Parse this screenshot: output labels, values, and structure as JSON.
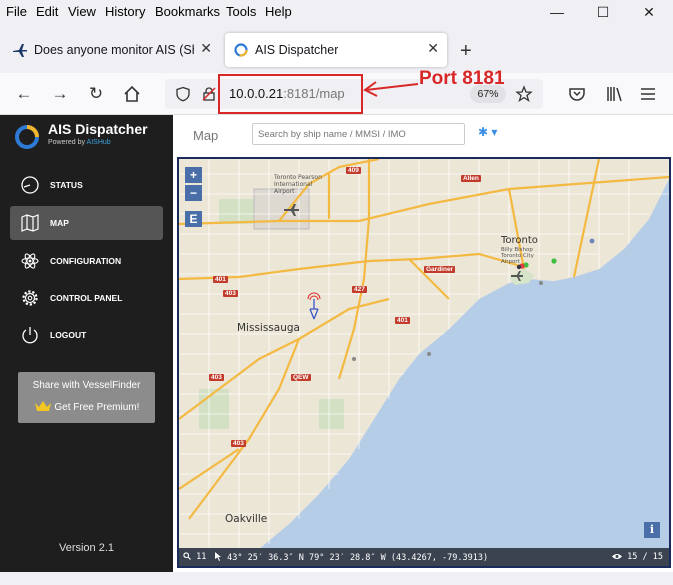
{
  "menubar": {
    "items": [
      "File",
      "Edit",
      "View",
      "History",
      "Bookmarks",
      "Tools",
      "Help"
    ],
    "window_controls": {
      "minimize": "—",
      "maximize": "☐",
      "close": "✕"
    }
  },
  "tabs": [
    {
      "label": "Does anyone monitor AIS (Ship",
      "icon": "airplane-icon",
      "close": "✕",
      "active": false
    },
    {
      "label": "AIS Dispatcher",
      "icon": "loading-ring-icon",
      "close": "✕",
      "active": true
    }
  ],
  "newtab": "+",
  "navbar": {
    "url_host": "10.0.0.21",
    "url_path": ":8181/map",
    "zoom": "67%"
  },
  "annotation": {
    "text": "Port 8181",
    "color": "#d82727"
  },
  "sidebar": {
    "title": "AIS Dispatcher",
    "subtitle_prefix": "Powered by ",
    "subtitle_link": "AISHub",
    "items": [
      {
        "label": "STATUS",
        "icon": "clock-icon",
        "active": false
      },
      {
        "label": "MAP",
        "icon": "map-icon",
        "active": true
      },
      {
        "label": "CONFIGURATION",
        "icon": "atom-icon",
        "active": false
      },
      {
        "label": "CONTROL PANEL",
        "icon": "gear-icon",
        "active": false
      },
      {
        "label": "LOGOUT",
        "icon": "power-icon",
        "active": false
      }
    ],
    "promo_line1": "Share with VesselFinder",
    "promo_line2": "Get Free Premium!",
    "version": "Version 2.1"
  },
  "main": {
    "title": "Map",
    "search_placeholder": "Search by ship name / MMSI / IMO",
    "map": {
      "zoom_in": "+",
      "zoom_out": "−",
      "layer_button": "E",
      "info_button": "i",
      "places": {
        "toronto": "Toronto",
        "mississauga": "Mississauga",
        "oakville": "Oakville",
        "airport": "Toronto Pearson International Airport",
        "billy_bishop": "Billy Bishop Toronto City Airport",
        "gardiner": "Gardiner",
        "allen": "Allen",
        "qew": "QEW"
      },
      "highways": [
        "409",
        "401",
        "427",
        "403",
        "403",
        "403",
        "401"
      ],
      "status": {
        "search_count": "11",
        "coords": "43° 25′ 36.3″ N 79° 23′ 28.8″ W (43.4267, -79.3913)",
        "ships": "15 / 15"
      }
    }
  }
}
